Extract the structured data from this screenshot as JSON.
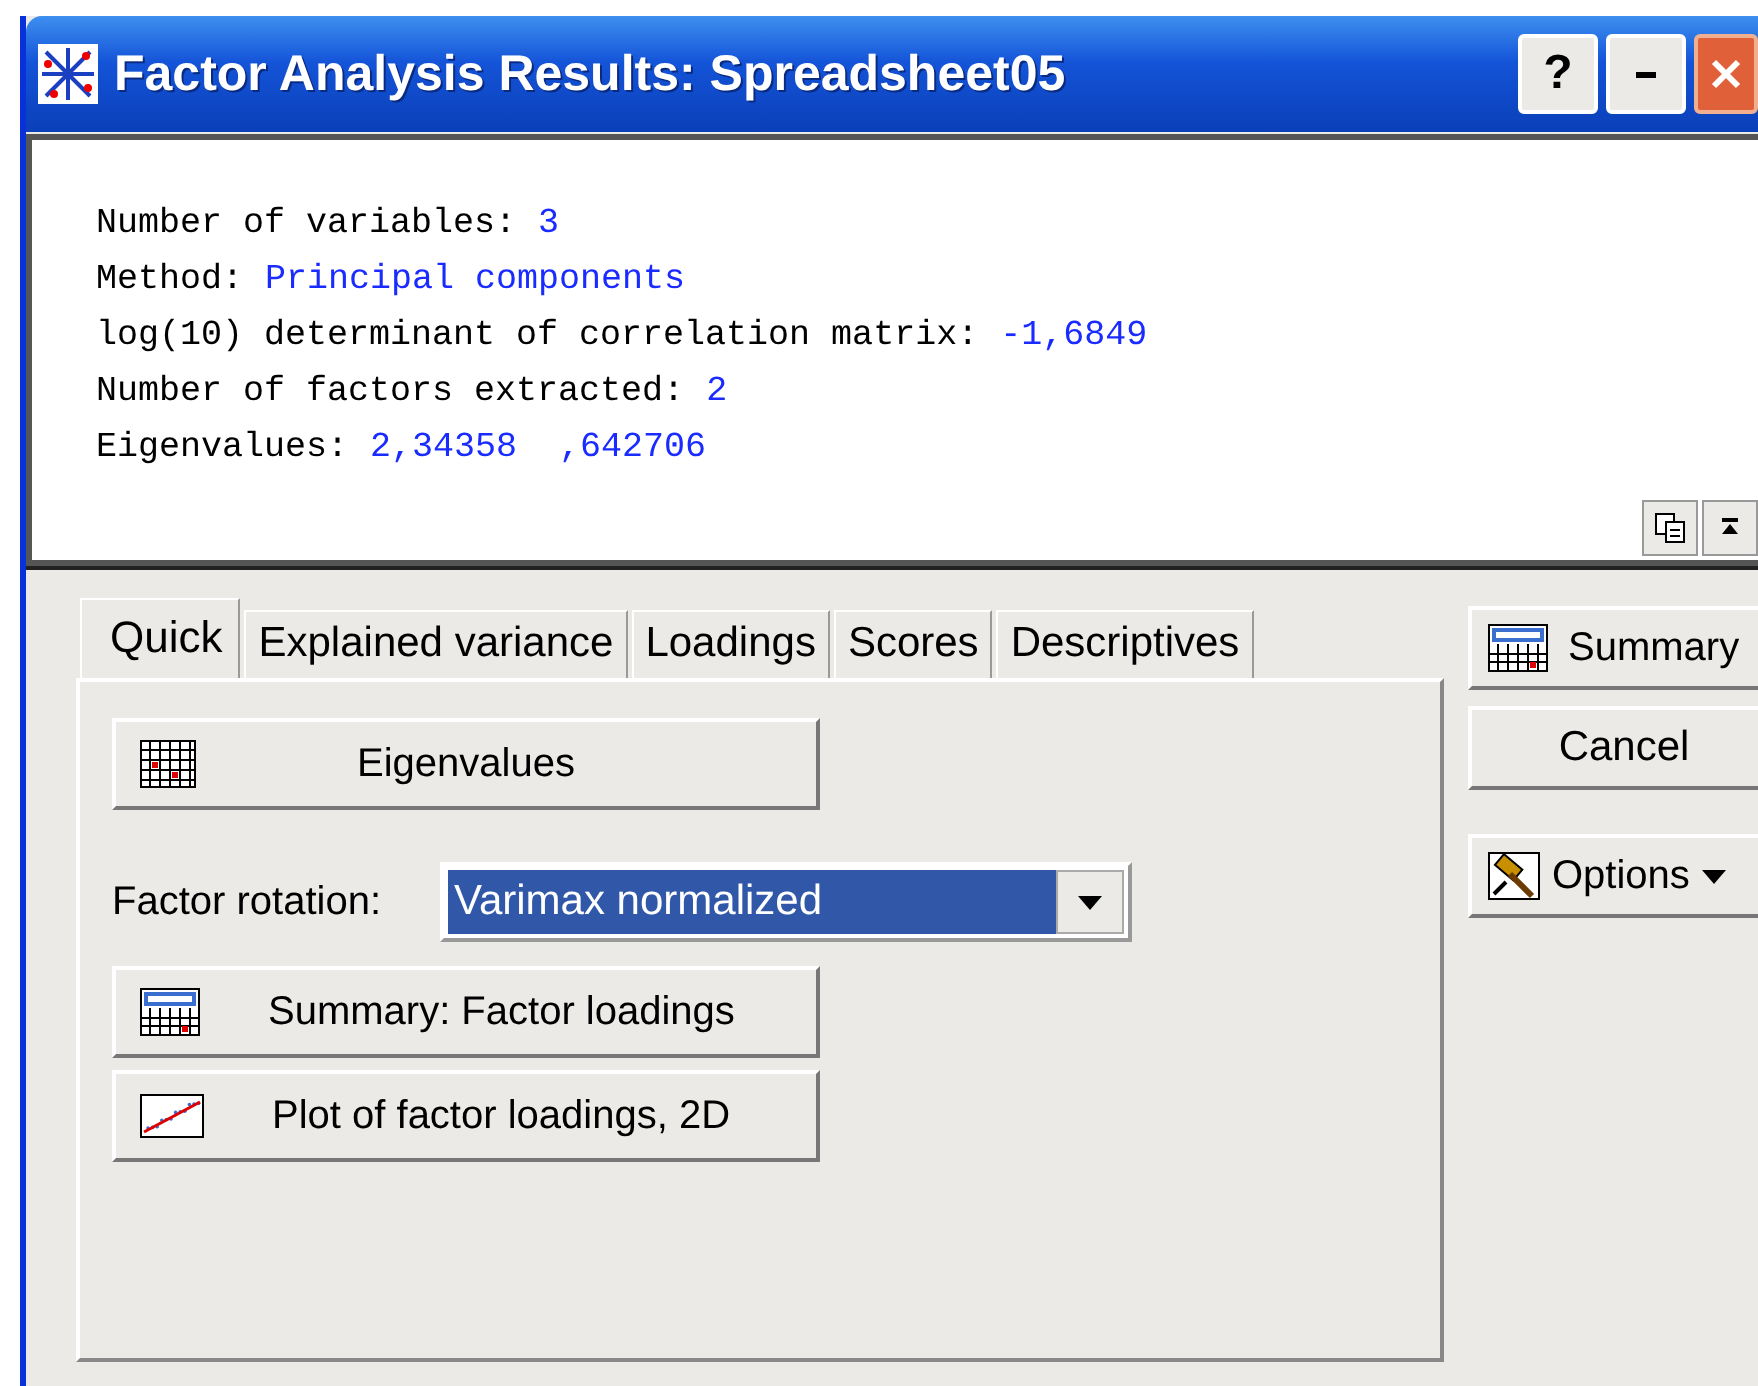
{
  "window": {
    "title": "Factor Analysis Results: Spreadsheet05",
    "buttons": [
      "?"
    ]
  },
  "output": [
    {
      "label": "Number of variables:",
      "value": "3"
    },
    {
      "label": "Method:",
      "value": "Principal components"
    },
    {
      "label": "log(10) determinant of correlation matrix:",
      "value": "-1,6849"
    },
    {
      "label": "Number of factors extracted:",
      "value": "2"
    },
    {
      "label": "Eigenvalues:",
      "value": "2,34358  ,642706"
    }
  ],
  "tabs": [
    {
      "label": "Quick",
      "selected": true
    },
    {
      "label": "Explained variance",
      "selected": false
    },
    {
      "label": "Loadings",
      "selected": false
    },
    {
      "label": "Scores",
      "selected": false
    },
    {
      "label": "Descriptives",
      "selected": false
    }
  ],
  "quick": {
    "eigen_button": "Eigenvalues",
    "rotation_label": "Factor rotation:",
    "rotation_value": "Varimax normalized",
    "summary_button": "Summary: Factor loadings",
    "plot_button": "Plot of factor loadings, 2D"
  },
  "side_buttons": [
    {
      "kind": "summary",
      "label": "Summary"
    },
    {
      "kind": "plain",
      "label": "Cancel"
    },
    {
      "kind": "options",
      "label": "Options"
    }
  ]
}
